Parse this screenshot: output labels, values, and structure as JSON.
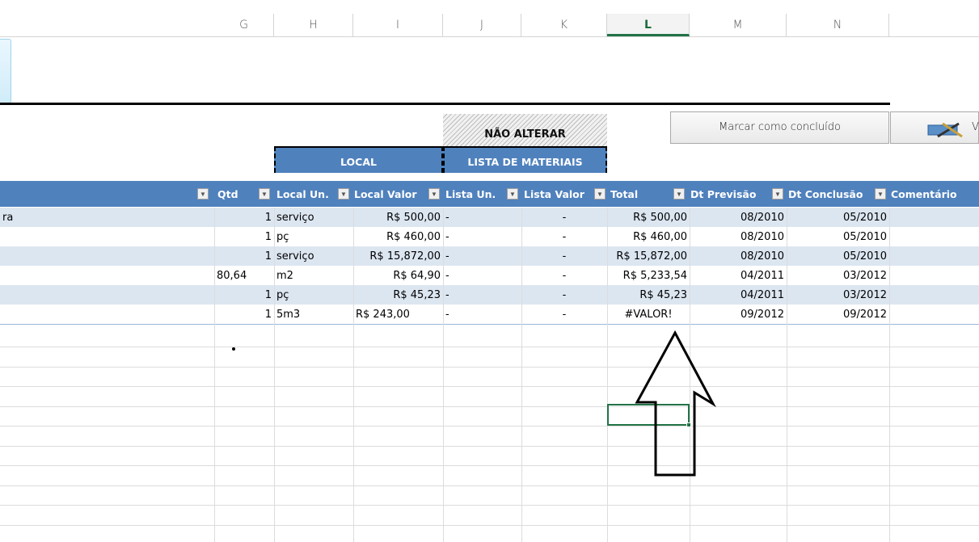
{
  "columns": [
    "G",
    "H",
    "I",
    "J",
    "K",
    "L",
    "M",
    "N"
  ],
  "selected_column": "L",
  "banner": {
    "nao_alterar": "NÃO ALTERAR"
  },
  "sections": {
    "local": "LOCAL",
    "lista": "LISTA DE MATERIAIS"
  },
  "buttons": {
    "marcar": "Marcar como concluído",
    "second_button_partial": "V"
  },
  "headers": {
    "qtd": "Qtd",
    "local_un": "Local Un.",
    "local_valor": "Local Valor",
    "lista_un": "Lista  Un.",
    "lista_valor": "Lista Valor",
    "total": "Total",
    "dt_previsao": "Dt Previsão",
    "dt_conclusao": "Dt Conclusão",
    "comentario": "Comentário"
  },
  "rows": [
    {
      "desc": "ra",
      "g": "",
      "qtd": "1",
      "local_un": "serviço",
      "local_valor": "R$ 500,00",
      "lista_un": "-",
      "lista_valor": "-",
      "total": "R$ 500,00",
      "dt_previsao": "08/2010",
      "dt_conclusao": "05/2010"
    },
    {
      "desc": "",
      "g": "",
      "qtd": "1",
      "local_un": "pç",
      "local_valor": "R$ 460,00",
      "lista_un": "-",
      "lista_valor": "-",
      "total": "R$ 460,00",
      "dt_previsao": "08/2010",
      "dt_conclusao": "05/2010"
    },
    {
      "desc": "",
      "g": "",
      "qtd": "1",
      "local_un": "serviço",
      "local_valor": "R$ 15,872,00",
      "lista_un": "-",
      "lista_valor": "-",
      "total": "R$ 15,872,00",
      "dt_previsao": "08/2010",
      "dt_conclusao": "05/2010"
    },
    {
      "desc": "",
      "g": "80,64",
      "qtd": "",
      "local_un": "m2",
      "local_valor": "R$ 64,90",
      "lista_un": "-",
      "lista_valor": "-",
      "total": "R$ 5,233,54",
      "dt_previsao": "04/2011",
      "dt_conclusao": "03/2012"
    },
    {
      "desc": "",
      "g": "",
      "qtd": "1",
      "local_un": "pç",
      "local_valor": "R$ 45,23",
      "lista_un": "-",
      "lista_valor": "-",
      "total": "R$ 45,23",
      "dt_previsao": "04/2011",
      "dt_conclusao": "03/2012"
    },
    {
      "desc": "",
      "g": "",
      "qtd": "1",
      "local_un": "5m3",
      "local_valor": "R$ 243,00",
      "lista_un": "-",
      "lista_valor": "-",
      "total": "#VALOR!",
      "dt_previsao": "09/2012",
      "dt_conclusao": "09/2012"
    }
  ]
}
